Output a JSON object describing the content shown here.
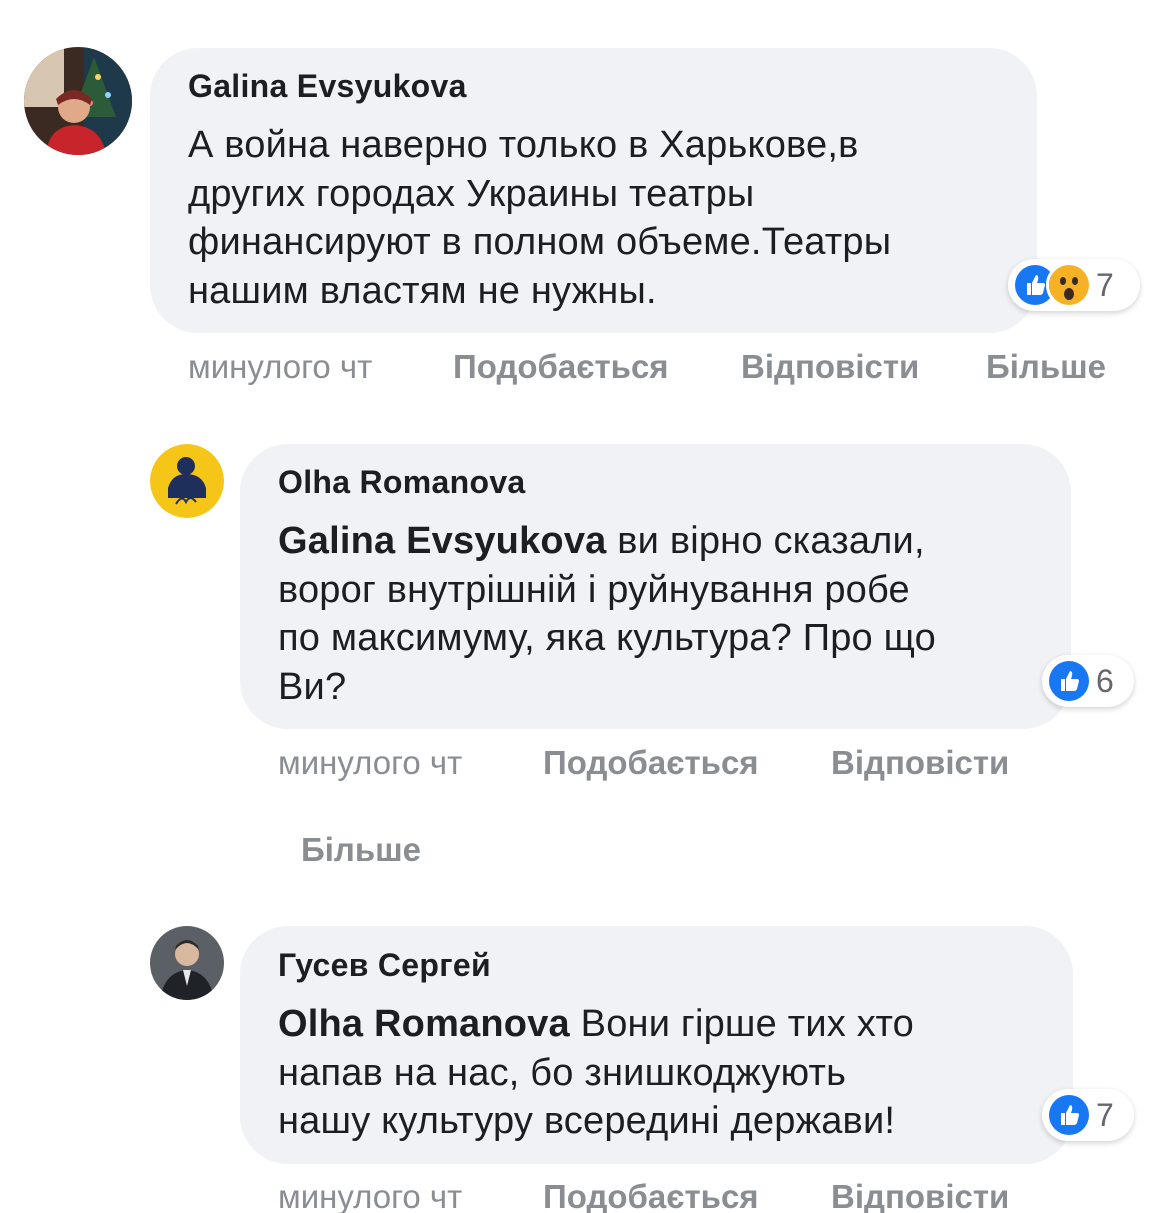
{
  "comments": [
    {
      "author": "Galina Evsyukova",
      "text": "А война наверно только в Харькове,в\nдругих городах Украины театры\nфинансируют в полном объеме.Театры\nнашим властям не нужны.",
      "reactions": {
        "icons": [
          "like-icon",
          "wow-icon"
        ],
        "count": "7"
      },
      "time": "минулого чт",
      "like_label": "Подобається",
      "reply_label": "Відповісти",
      "more_label": "Більше"
    },
    {
      "author": "Olha Romanova",
      "mention": "Galina Evsyukova",
      "text": " ви вірно сказали,\nворог внутрішній і руйнування робе\nпо максимуму, яка культура? Про що\nВи?",
      "reactions": {
        "icons": [
          "like-icon"
        ],
        "count": "6"
      },
      "time": "минулого чт",
      "like_label": "Подобається",
      "reply_label": "Відповісти",
      "more_label": "Більше"
    },
    {
      "author": "Гусев Сергей",
      "mention": "Olha Romanova",
      "text": " Вони гірше тих хто\nнапав на нас, бо знишкоджують\nнашу культуру всередині держави!",
      "reactions": {
        "icons": [
          "like-icon"
        ],
        "count": "7"
      },
      "time": "минулого чт",
      "like_label": "Подобається",
      "reply_label": "Відповісти"
    }
  ],
  "colors": {
    "bubble": "#f0f2f5",
    "text": "#1c1e21",
    "meta": "#8a8d91",
    "like_blue": "#1877f2",
    "wow_yellow": "#f7b125"
  }
}
